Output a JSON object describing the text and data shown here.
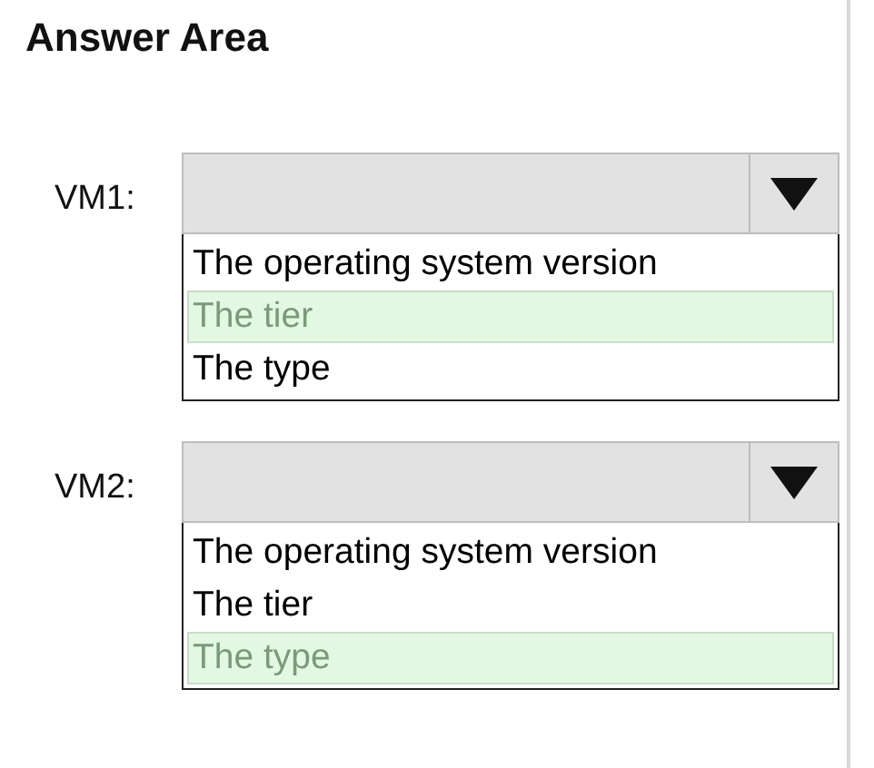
{
  "title": "Answer Area",
  "dropdowns": [
    {
      "label": "VM1:",
      "options": [
        {
          "text": "The operating system version",
          "selected": false
        },
        {
          "text": "The tier",
          "selected": true
        },
        {
          "text": "The type",
          "selected": false
        }
      ]
    },
    {
      "label": "VM2:",
      "options": [
        {
          "text": "The operating system version",
          "selected": false
        },
        {
          "text": "The tier",
          "selected": false
        },
        {
          "text": "The type",
          "selected": true
        }
      ]
    }
  ]
}
